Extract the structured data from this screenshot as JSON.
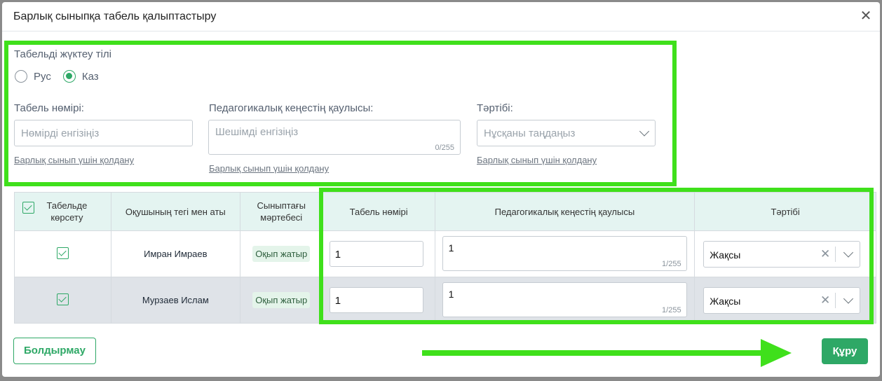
{
  "dialog": {
    "title": "Барлық сыныпқа табель қалыптастыру"
  },
  "language": {
    "label": "Табельді жүктеу тілі",
    "options": [
      "Рус",
      "Каз"
    ],
    "selected": "Каз"
  },
  "fields": {
    "number": {
      "label": "Табель нөмірі:",
      "placeholder": "Нөмірді енгізіңіз",
      "apply_link": "Барлық сынып үшін қолдану"
    },
    "decision": {
      "label": "Педагогикалық кеңестің қаулысы:",
      "placeholder": "Шешімді енгізіңіз",
      "counter": "0/255",
      "apply_link": "Барлық сынып үшін қолдану"
    },
    "conduct": {
      "label": "Тәртібі:",
      "placeholder": "Нұсқаны таңдаңыз",
      "apply_link": "Барлық сынып үшін қолдану"
    }
  },
  "table": {
    "headers": [
      "Табельде көрсету",
      "Оқушының тегі мен аты",
      "Сыныптағы мәртебесі",
      "Табель нөмірі",
      "Педагогикалық кеңестің қаулысы",
      "Тәртібі"
    ],
    "rows": [
      {
        "show": true,
        "name": "Имран Имраев",
        "status": "Оқып жатыр",
        "number": "1",
        "decision": "1",
        "counter": "1/255",
        "conduct": "Жақсы"
      },
      {
        "show": true,
        "name": "Мурзаев Ислам",
        "status": "Оқып жатыр",
        "number": "1",
        "decision": "1",
        "counter": "1/255",
        "conduct": "Жақсы"
      }
    ]
  },
  "footer": {
    "cancel_label": "Болдырмау",
    "create_label": "Құру"
  },
  "colors": {
    "accent": "#2ea866",
    "highlight": "#3fe01b",
    "header_bg": "#e4f4f1"
  },
  "icons": {
    "close": "close-icon",
    "chevron": "chevron-down-icon",
    "clear": "clear-icon"
  }
}
